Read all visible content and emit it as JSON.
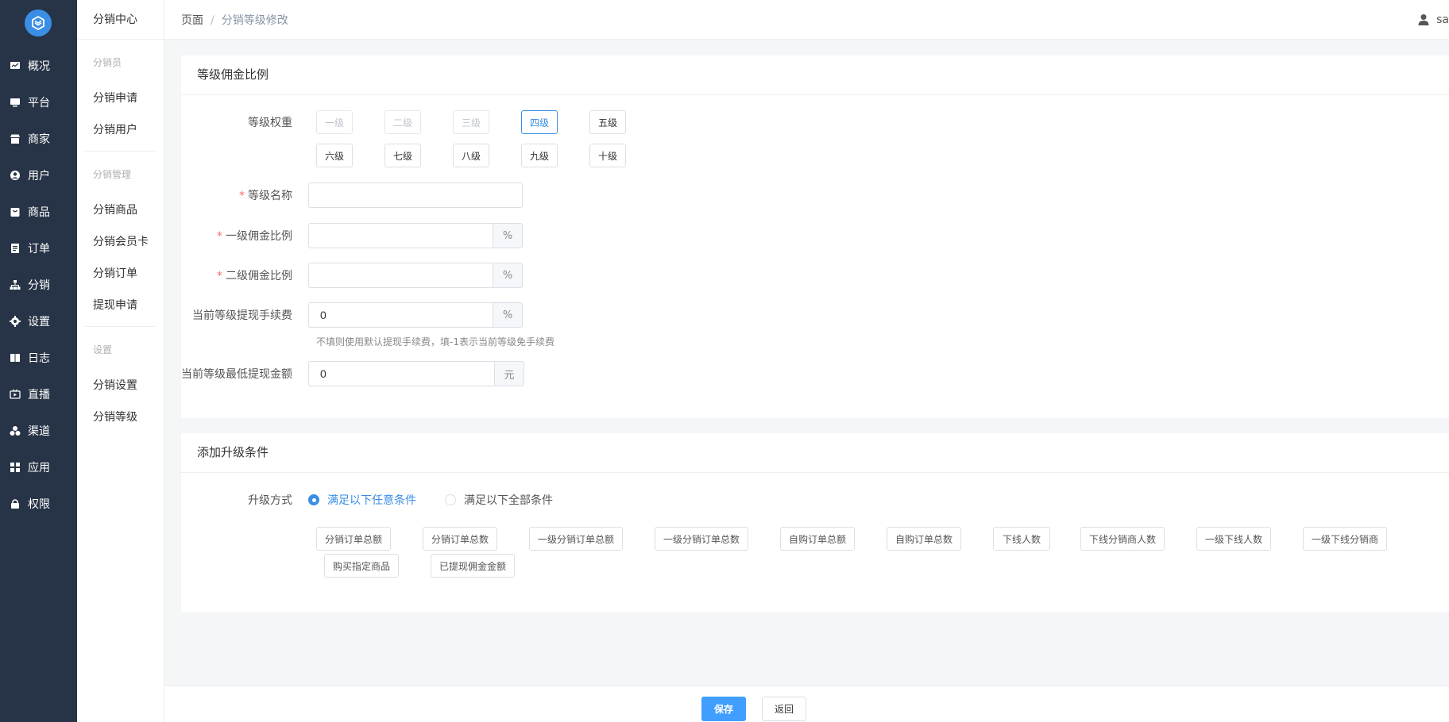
{
  "sidebar": {
    "items": [
      {
        "label": "概况",
        "icon": "dashboard-icon"
      },
      {
        "label": "平台",
        "icon": "monitor-icon"
      },
      {
        "label": "商家",
        "icon": "store-icon"
      },
      {
        "label": "用户",
        "icon": "user-icon"
      },
      {
        "label": "商品",
        "icon": "bag-icon"
      },
      {
        "label": "订单",
        "icon": "order-icon"
      },
      {
        "label": "分销",
        "icon": "sitemap-icon"
      },
      {
        "label": "设置",
        "icon": "gear-icon"
      },
      {
        "label": "日志",
        "icon": "book-icon"
      },
      {
        "label": "直播",
        "icon": "tv-icon"
      },
      {
        "label": "渠道",
        "icon": "cluster-icon"
      },
      {
        "label": "应用",
        "icon": "grid-icon"
      },
      {
        "label": "权限",
        "icon": "lock-icon"
      }
    ]
  },
  "subbar": {
    "title": "分销中心",
    "group1": "分销员",
    "link_apply": "分销申请",
    "link_users": "分销用户",
    "group2": "分销管理",
    "link_goods": "分销商品",
    "link_card": "分销会员卡",
    "link_orders": "分销订单",
    "link_withdraw": "提现申请",
    "group3": "设置",
    "link_settings": "分销设置",
    "link_level": "分销等级"
  },
  "header": {
    "crumb_root": "页面",
    "crumb_sep": "/",
    "crumb_current": "分销等级修改",
    "user_name": "sa"
  },
  "commission": {
    "title": "等级佣金比例",
    "weight_label": "等级权重",
    "levels": [
      "一级",
      "二级",
      "三级",
      "四级",
      "五级",
      "六级",
      "七级",
      "八级",
      "九级",
      "十级"
    ],
    "name_label": "等级名称",
    "name_value": "",
    "first_label": "一级佣金比例",
    "first_value": "",
    "second_label": "二级佣金比例",
    "second_value": "",
    "fee_label": "当前等级提现手续费",
    "fee_value": "0",
    "fee_hint": "不填则使用默认提现手续费，填-1表示当前等级免手续费",
    "min_label": "当前等级最低提现金额",
    "min_value": "0",
    "percent_suffix": "%",
    "yuan_suffix": "元"
  },
  "upgrade": {
    "title": "添加升级条件",
    "mode_label": "升级方式",
    "mode_any": "满足以下任意条件",
    "mode_all": "满足以下全部条件",
    "conditions": [
      "分销订单总额",
      "分销订单总数",
      "一级分销订单总额",
      "一级分销订单总数",
      "自购订单总额",
      "自购订单总数",
      "下线人数",
      "下线分销商人数",
      "一级下线人数",
      "一级下线分销商",
      "购买指定商品",
      "已提现佣金金额"
    ]
  },
  "footer": {
    "save_label": "保存",
    "back_label": "返回"
  }
}
